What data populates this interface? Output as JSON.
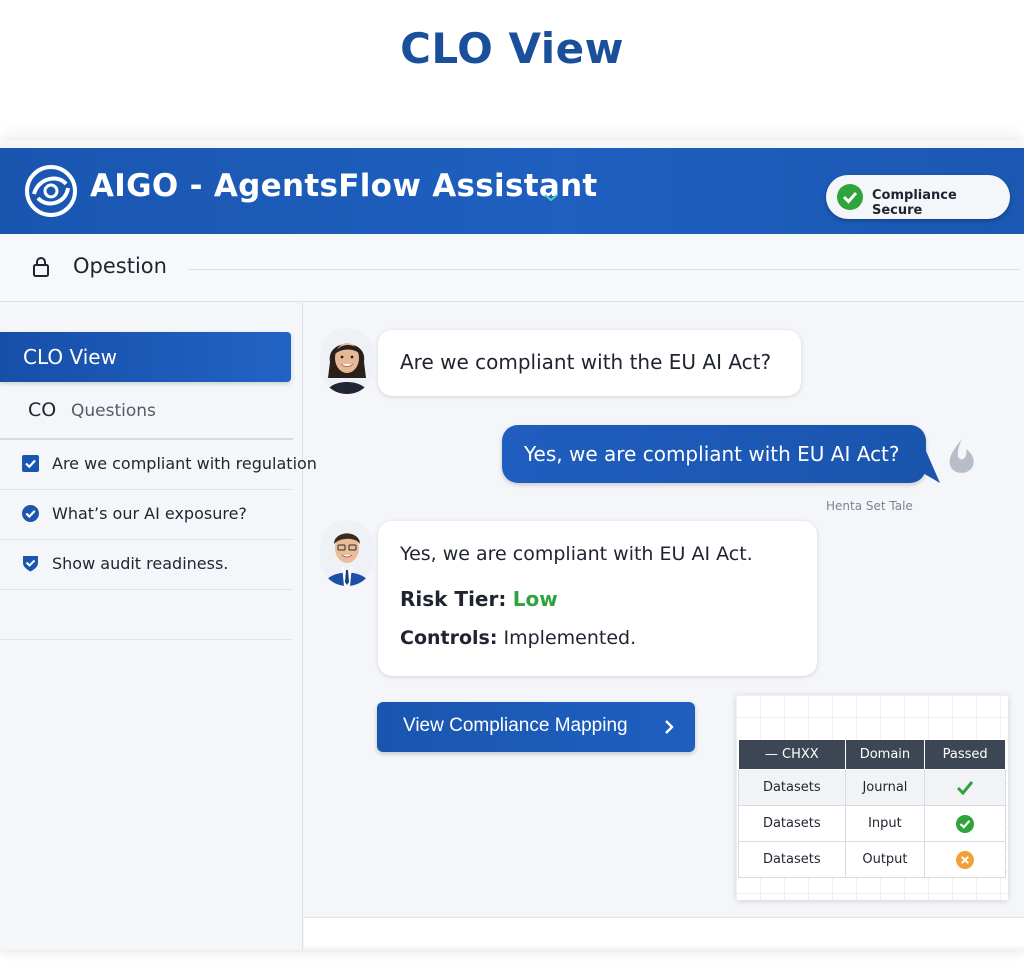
{
  "page": {
    "title": "CLO View"
  },
  "header": {
    "app_title": "AIGO - AgentsFlow Assistant",
    "badge_label": "Compliance Secure"
  },
  "subbar": {
    "label": "Opestion"
  },
  "sidebar": {
    "active_item": "CLO View",
    "section_prefix": "CO",
    "section_title": "Questions",
    "questions": [
      {
        "label": "Are we compliant with regulation",
        "icon": "checkbox-checked-icon"
      },
      {
        "label": "What’s our AI exposure?",
        "icon": "check-circle-icon"
      },
      {
        "label": "Show audit readiness.",
        "icon": "shield-check-icon"
      }
    ]
  },
  "chat": {
    "question": "Are we compliant with the EU AI Act?",
    "user_reply": "Yes, we are compliant with EU AI Act?",
    "meta": "Henta Set Tale",
    "answer_line1": "Yes, we are compliant with EU AI Act.",
    "risk_label": "Risk Tier:",
    "risk_value": "Low",
    "controls_label": "Controls:",
    "controls_value": "Implemented.",
    "mapping_button": "View Compliance Mapping"
  },
  "table": {
    "headers": [
      "CHXX",
      "Domain",
      "Passed"
    ],
    "rows": [
      {
        "item": "Datasets",
        "domain": "Journal",
        "status": "check"
      },
      {
        "item": "Datasets",
        "domain": "Input",
        "status": "check-circle"
      },
      {
        "item": "Datasets",
        "domain": "Output",
        "status": "warning"
      }
    ]
  },
  "colors": {
    "brand_blue": "#1a56b0",
    "success_green": "#2fa43c",
    "warning_orange": "#f0a238",
    "table_header": "#3c4654"
  }
}
